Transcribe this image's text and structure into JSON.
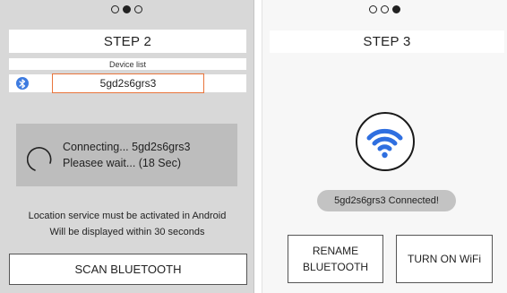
{
  "colors": {
    "bluetooth_blue": "#3d7be0",
    "wifi_blue": "#2f6fe0",
    "highlight_orange": "#e8743b"
  },
  "step2": {
    "title": "STEP 2",
    "device_list_label": "Device list",
    "device_name": "5gd2s6grs3",
    "connecting_line1": "Connecting... 5gd2s6grs3",
    "connecting_line2": "Pleasee wait... (18 Sec)",
    "info_line1": "Location service must be activated in Android",
    "info_line2": "Will be displayed within 30 seconds",
    "scan_button": "SCAN BLUETOOTH",
    "icons": [
      "bluetooth-icon",
      "spinner-icon"
    ]
  },
  "step3": {
    "title": "STEP 3",
    "connected_text": "5gd2s6grs3 Connected!",
    "rename_line1": "RENAME",
    "rename_line2": "BLUETOOTH",
    "turn_on_wifi": "TURN ON WiFi",
    "icons": [
      "wifi-icon"
    ]
  }
}
